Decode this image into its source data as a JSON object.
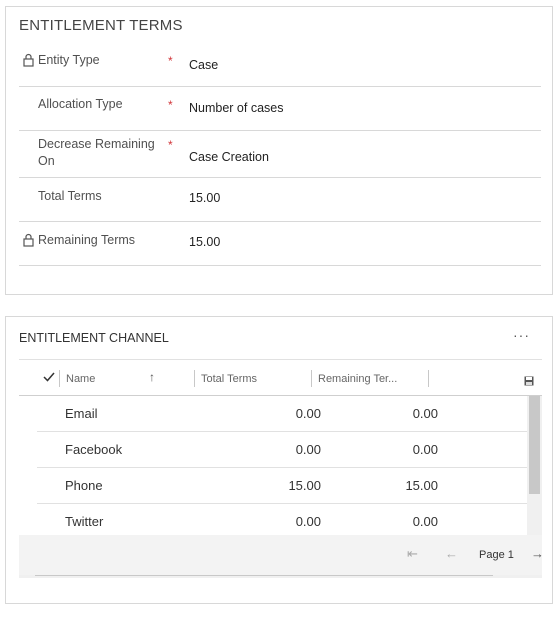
{
  "entitlement_terms": {
    "title": "ENTITLEMENT TERMS",
    "fields": [
      {
        "label": "Entity Type",
        "value": "Case",
        "locked": true,
        "required": true
      },
      {
        "label": "Allocation Type",
        "value": "Number of cases",
        "locked": false,
        "required": true
      },
      {
        "label": "Decrease Remaining On",
        "value": "Case Creation",
        "locked": false,
        "required": true
      },
      {
        "label": "Total Terms",
        "value": "15.00",
        "locked": false,
        "required": false
      },
      {
        "label": "Remaining Terms",
        "value": "15.00",
        "locked": true,
        "required": false
      }
    ],
    "required_marker": "*"
  },
  "entitlement_channel": {
    "title": "ENTITLEMENT CHANNEL",
    "more_label": "···",
    "columns": [
      "Name",
      "Total Terms",
      "Remaining Ter..."
    ],
    "sort_indicator": "↑",
    "rows": [
      {
        "name": "Email",
        "total": "0.00",
        "remaining": "0.00"
      },
      {
        "name": "Facebook",
        "total": "0.00",
        "remaining": "0.00"
      },
      {
        "name": "Phone",
        "total": "15.00",
        "remaining": "15.00"
      },
      {
        "name": "Twitter",
        "total": "0.00",
        "remaining": "0.00"
      }
    ],
    "pager": {
      "first": "⇤",
      "prev": "←",
      "label": "Page 1",
      "next": "→"
    }
  },
  "colors": {
    "required": "#d13438",
    "border": "#d8d8d8",
    "pager_bg": "#f3f3f3"
  }
}
